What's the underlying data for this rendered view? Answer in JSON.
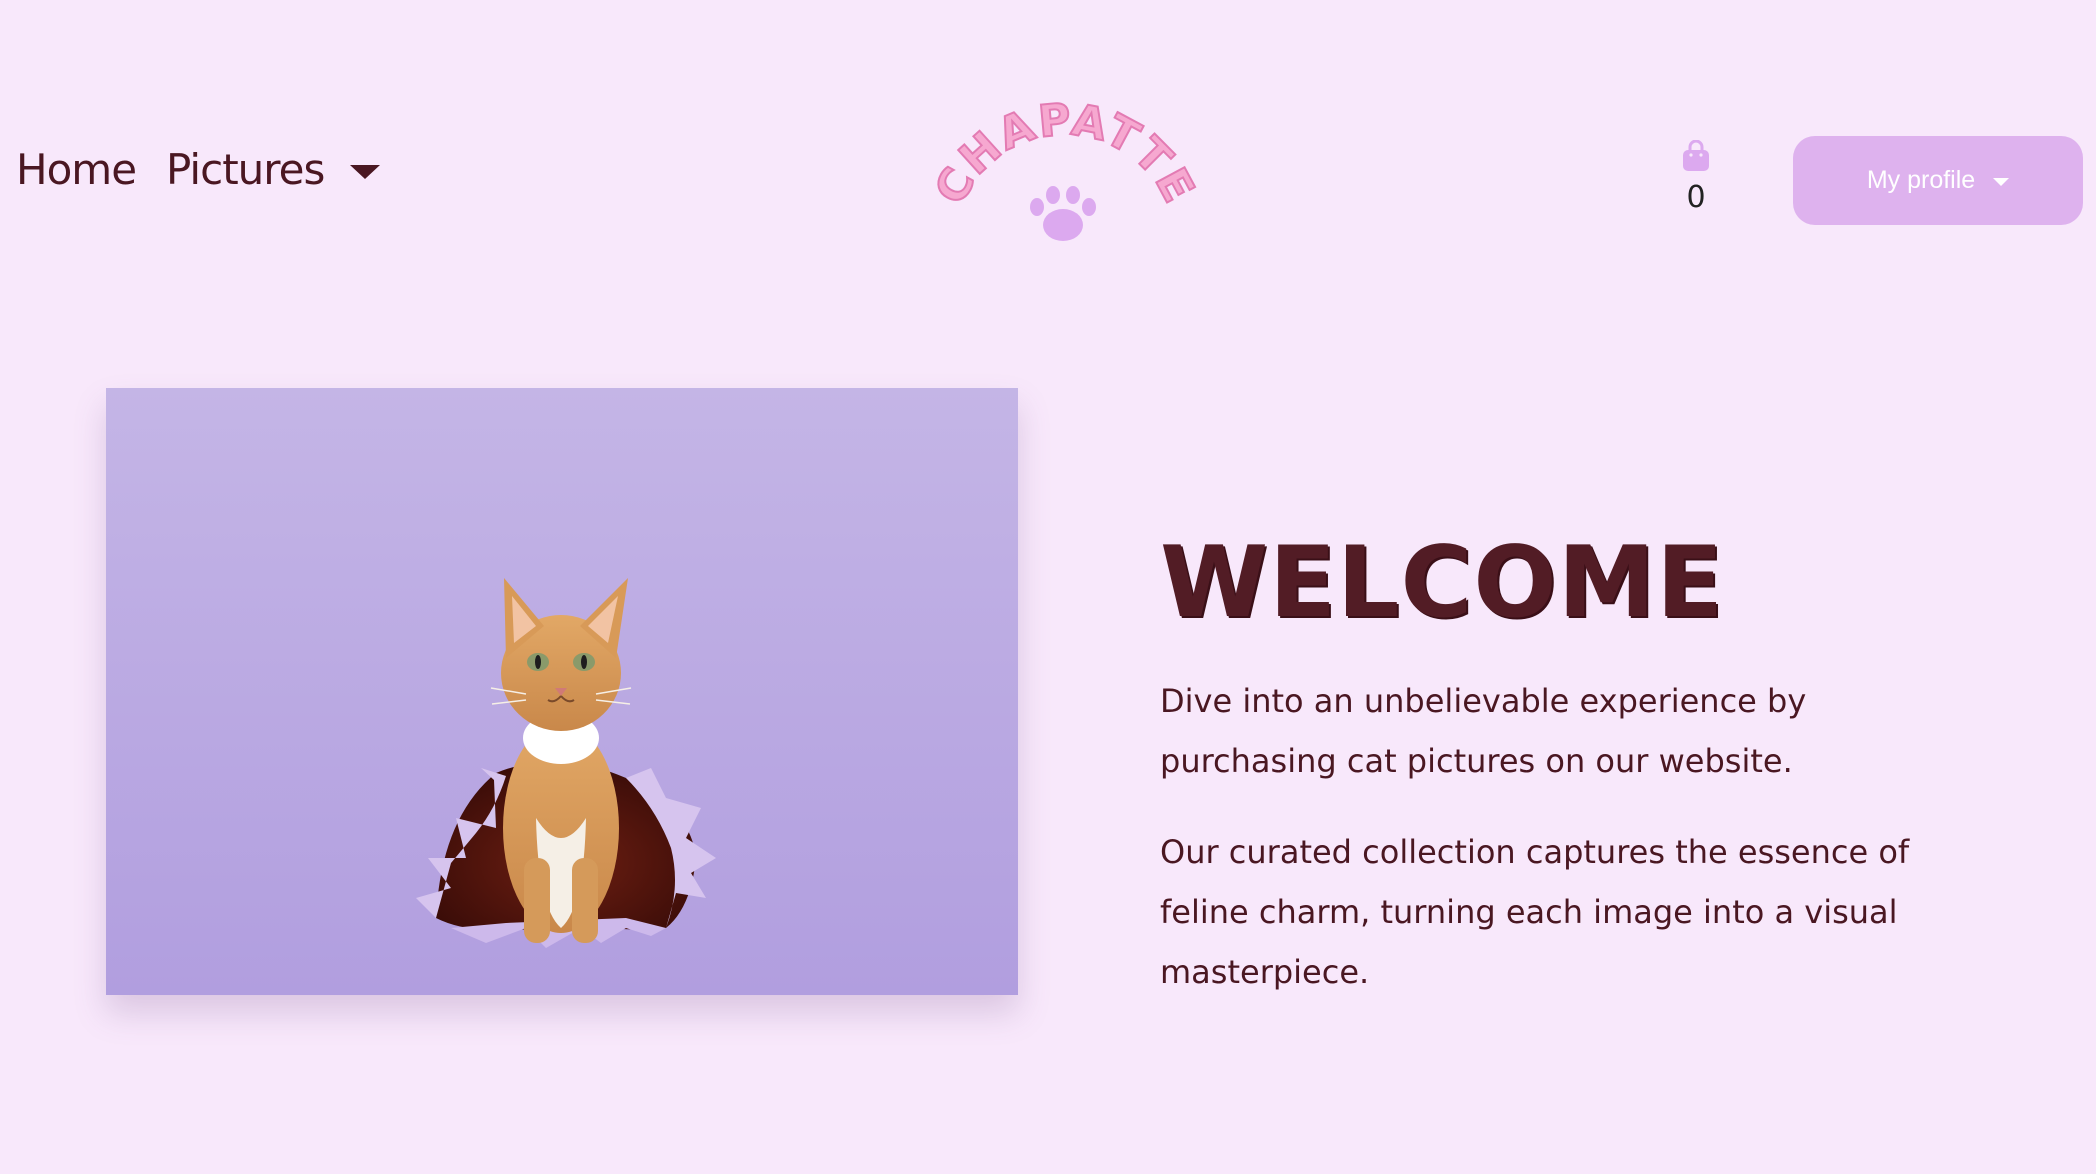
{
  "nav": {
    "home_label": "Home",
    "pictures_label": "Pictures"
  },
  "logo": {
    "text": "CHAPATTE",
    "icon": "paw-icon"
  },
  "cart": {
    "icon": "shopping-bag-icon",
    "count": "0"
  },
  "profile": {
    "label": "My profile"
  },
  "hero": {
    "image_alt": "orange kitten emerging from torn purple paper",
    "title": "WELCOME",
    "paragraph_1": "Dive into an unbelievable experience by purchasing cat pictures on our website.",
    "paragraph_2": "Our curated collection captures the essence of feline charm, turning each image into a visual masterpiece."
  },
  "colors": {
    "background": "#f8e8fb",
    "text": "#4a1722",
    "accent": "#deb2ee",
    "logo_pink": "#f3a6cf"
  }
}
